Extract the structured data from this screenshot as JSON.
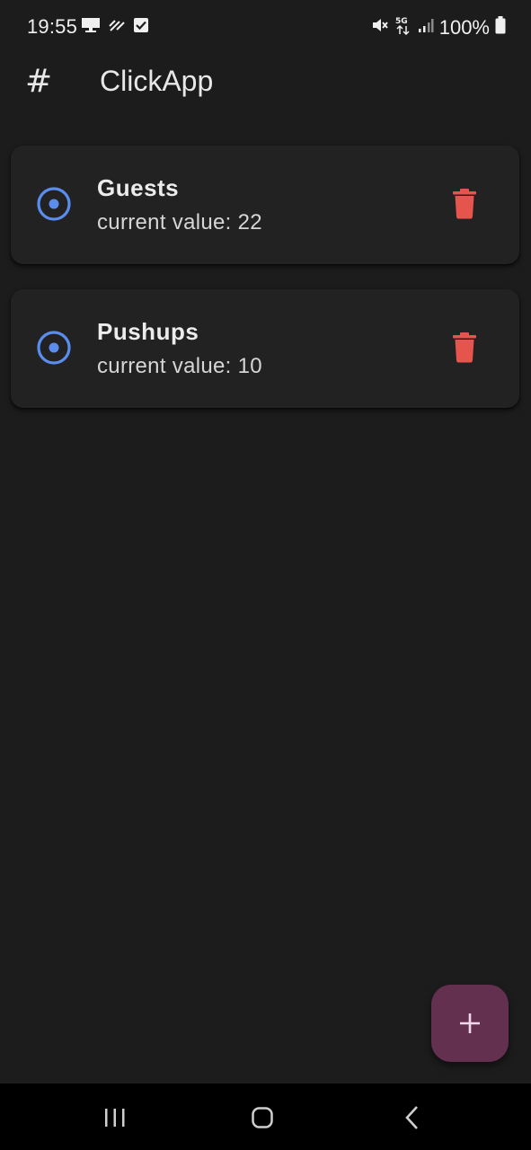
{
  "status_bar": {
    "time": "19:55",
    "battery": "100%",
    "icons": [
      "monitor-icon",
      "tiles-icon",
      "checkbox-icon",
      "mute-icon",
      "5g-icon",
      "signal-icon",
      "battery-icon"
    ]
  },
  "app_bar": {
    "icon_glyph": "#",
    "title": "ClickApp"
  },
  "counters": [
    {
      "name": "Guests",
      "subtitle": "current value: 22"
    },
    {
      "name": "Pushups",
      "subtitle": "current value: 10"
    }
  ],
  "fab": {
    "icon": "plus-icon"
  },
  "colors": {
    "background": "#1c1c1d",
    "card": "#222223",
    "radio_accent": "#5b8def",
    "delete_red": "#e5544d",
    "fab_bg": "#64304f",
    "fab_icon": "#f2d6ea"
  },
  "nav_bar": {
    "icons": [
      "recents-icon",
      "home-icon",
      "back-icon"
    ]
  }
}
